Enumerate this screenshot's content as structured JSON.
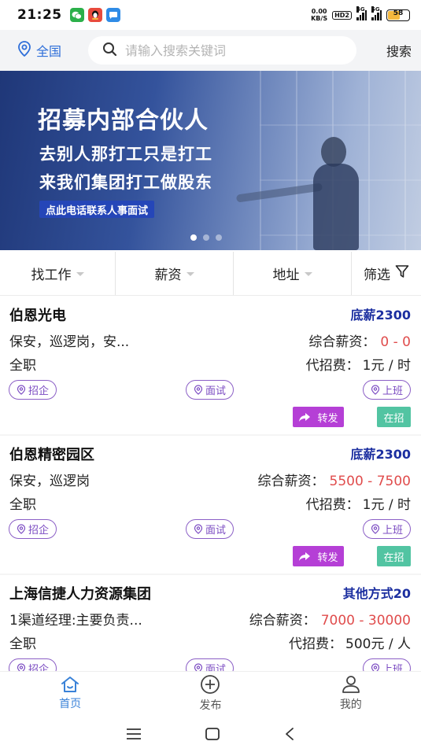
{
  "statusbar": {
    "time": "21:25",
    "net_speed_value": "0.00",
    "net_speed_unit": "KB/S",
    "hd_label": "HD2",
    "sig1_label": "4G",
    "sig2_label": "5G",
    "battery": "58",
    "app_icons": [
      "wechat-icon",
      "qq-icon",
      "message-icon"
    ]
  },
  "topbar": {
    "location": "全国",
    "search_placeholder": "请输入搜索关键词",
    "search_button": "搜索"
  },
  "banner": {
    "title": "招募内部合伙人",
    "line1": "去别人那打工只是打工",
    "line2": "来我们集团打工做股东",
    "tag": "点此电话联系人事面试",
    "dots": 3,
    "active_dot": 0
  },
  "filters": [
    {
      "label": "找工作",
      "has_caret": true
    },
    {
      "label": "薪资",
      "has_caret": true
    },
    {
      "label": "地址",
      "has_caret": true
    },
    {
      "label": "筛选",
      "has_caret": false
    }
  ],
  "job_labels": {
    "salary_prefix": "综合薪资：",
    "fee_prefix": "代招费：",
    "tag1": "招企",
    "tag2": "面试",
    "tag3": "上班",
    "share": "转发",
    "status": "在招"
  },
  "jobs": [
    {
      "company": "伯恩光电",
      "base_pay": "底薪2300",
      "positions": "保安，巡逻岗，安...",
      "salary": "0 - 0",
      "type": "全职",
      "fee": "1元 / 时"
    },
    {
      "company": "伯恩精密园区",
      "base_pay": "底薪2300",
      "positions": "保安，巡逻岗",
      "salary": "5500 - 7500",
      "type": "全职",
      "fee": "1元 / 时"
    },
    {
      "company": "上海信捷人力资源集团",
      "base_pay": "其他方式20",
      "positions": "1渠道经理:主要负责...",
      "salary": "7000 - 30000",
      "type": "全职",
      "fee": "500元 / 人"
    }
  ],
  "tabbar": {
    "items": [
      {
        "label": "首页",
        "icon": "home-icon",
        "active": true
      },
      {
        "label": "发布",
        "icon": "plus-circle-icon",
        "active": false
      },
      {
        "label": "我的",
        "icon": "user-icon",
        "active": false
      }
    ]
  },
  "colors": {
    "accent": "#3a82d8",
    "base_pay": "#1c2fa0",
    "salary_value": "#e04c4c",
    "tag_purple": "#7b4bc2",
    "share_button": "#b53fd6",
    "status_badge": "#52c4a2"
  }
}
